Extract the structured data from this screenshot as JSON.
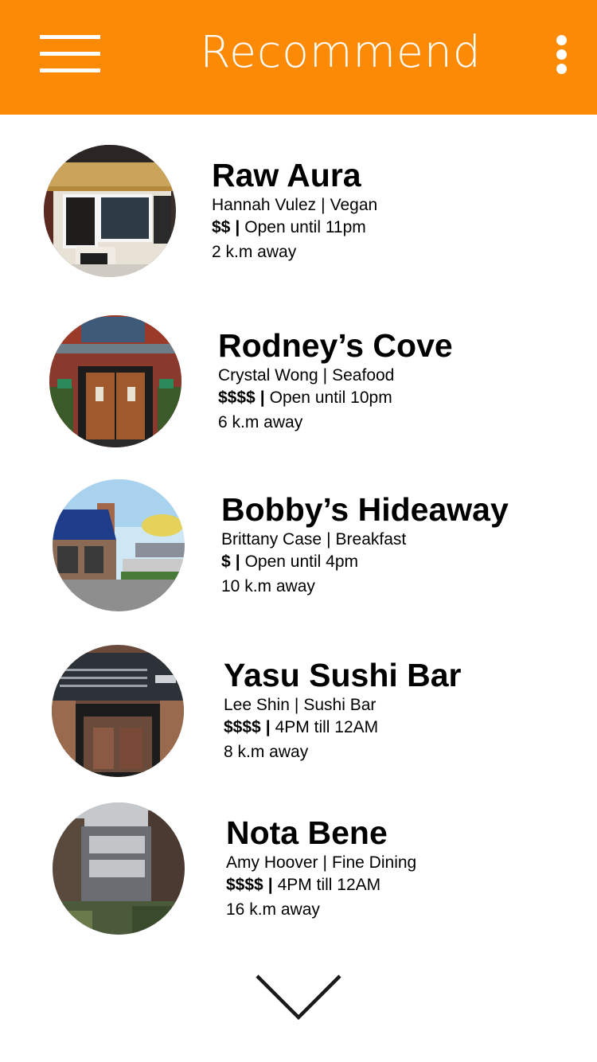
{
  "header": {
    "title": "Recommend",
    "menu_icon": "hamburger-menu-icon",
    "more_icon": "vertical-dots-icon",
    "color": "#fc8a05"
  },
  "restaurants": [
    {
      "name": "Raw Aura",
      "owner": "Hannah Vulez",
      "cuisine": "Vegan",
      "price": "$$",
      "hours": "Open until 11pm",
      "distance": "2 k.m away"
    },
    {
      "name": "Rodney’s Cove",
      "owner": "Crystal Wong",
      "cuisine": "Seafood",
      "price": "$$$$",
      "hours": "Open until 10pm",
      "distance": "6 k.m away"
    },
    {
      "name": "Bobby’s Hideaway",
      "owner": "Brittany Case",
      "cuisine": "Breakfast",
      "price": "$",
      "hours": "Open until 4pm",
      "distance": "10 k.m away"
    },
    {
      "name": "Yasu Sushi Bar",
      "owner": "Lee Shin",
      "cuisine": "Sushi Bar",
      "price": "$$$$",
      "hours": "4PM till 12AM",
      "distance": "8 k.m away"
    },
    {
      "name": "Nota Bene",
      "owner": "Amy Hoover",
      "cuisine": "Fine Dining",
      "price": "$$$$",
      "hours": "4PM till 12AM",
      "distance": "16 k.m away"
    }
  ],
  "footer": {
    "scroll_icon": "chevron-down-icon"
  }
}
